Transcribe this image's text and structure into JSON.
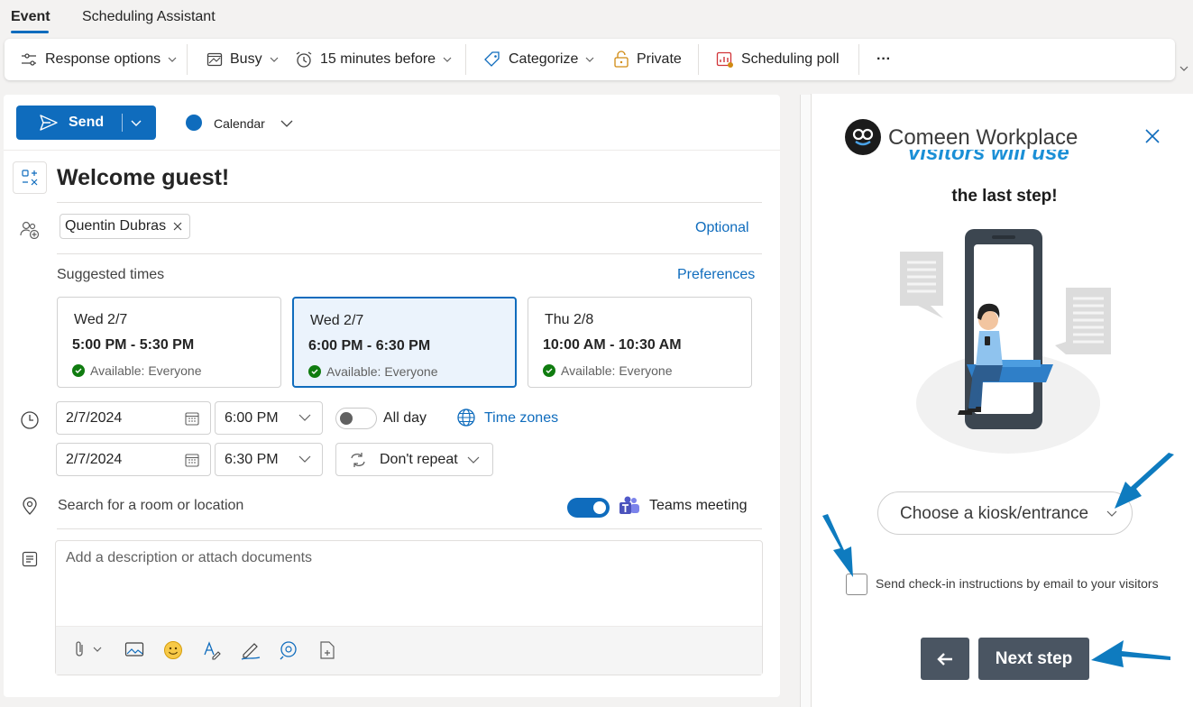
{
  "tabs": [
    {
      "label": "Event",
      "active": true
    },
    {
      "label": "Scheduling Assistant",
      "active": false
    }
  ],
  "ribbon": {
    "response_options": "Response options",
    "busy": "Busy",
    "reminder": "15 minutes before",
    "categorize": "Categorize",
    "private": "Private",
    "scheduling_poll": "Scheduling poll",
    "more": "···"
  },
  "compose": {
    "send_label": "Send",
    "calendar_label": "Calendar",
    "title": "Welcome guest!",
    "attendee": "Quentin Dubras",
    "optional_link": "Optional",
    "suggested_label": "Suggested times",
    "preferences_link": "Preferences",
    "suggestions": [
      {
        "date": "Wed 2/7",
        "time": "5:00 PM - 5:30 PM",
        "availability": "Available: Everyone",
        "selected": false
      },
      {
        "date": "Wed 2/7",
        "time": "6:00 PM - 6:30 PM",
        "availability": "Available: Everyone",
        "selected": true
      },
      {
        "date": "Thu 2/8",
        "time": "10:00 AM - 10:30 AM",
        "availability": "Available: Everyone",
        "selected": false
      }
    ],
    "start_date": "2/7/2024",
    "start_time": "6:00 PM",
    "end_date": "2/7/2024",
    "end_time": "6:30 PM",
    "all_day_label": "All day",
    "time_zones_link": "Time zones",
    "repeat_label": "Don't repeat",
    "location_placeholder": "Search for a room or location",
    "teams_label": "Teams meeting",
    "description_placeholder": "Add a description or attach documents"
  },
  "addin": {
    "brand": "Comeen Workplace",
    "cut_heading": "visitors will use",
    "heading": "the last step!",
    "kiosk_placeholder": "Choose a kiosk/entrance",
    "checkbox_label": "Send check-in instructions by email to your visitors",
    "next_button": "Next step"
  },
  "colors": {
    "accent": "#0f6cbd",
    "addin_button": "#4a5562",
    "annotation_arrow": "#0e7bbf",
    "available_green": "#107c10"
  }
}
